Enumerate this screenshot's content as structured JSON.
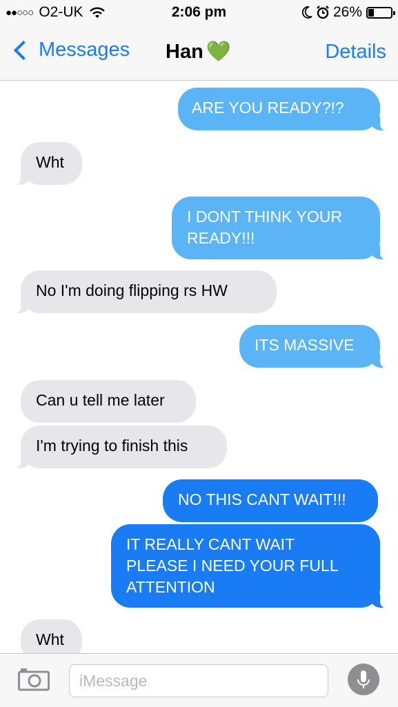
{
  "status_bar": {
    "signal": "●●○○○",
    "carrier": "O2-UK",
    "time": "2:06 pm",
    "battery_pct": "26%",
    "battery_level": 0.26
  },
  "nav": {
    "back_label": "Messages",
    "title": "Han",
    "title_emoji": "💚",
    "details_label": "Details"
  },
  "messages": [
    {
      "from": "me",
      "text": "ARE YOU READY?!?"
    },
    {
      "from": "them",
      "text": "Wht"
    },
    {
      "from": "me",
      "text": "I DONT THINK YOUR\nREADY!!!"
    },
    {
      "from": "them",
      "text": "No I'm doing flipping rs HW"
    },
    {
      "from": "me",
      "text": "ITS MASSIVE"
    },
    {
      "from": "them",
      "text": "Can u tell me later"
    },
    {
      "from": "them",
      "text": "I'm trying to finish this"
    },
    {
      "from": "me",
      "text": "NO THIS CANT WAIT!!!"
    },
    {
      "from": "me",
      "text": "IT REALLY CANT WAIT\nPLEASE I NEED YOUR FULL\nATTENTION"
    },
    {
      "from": "them",
      "text": "Wht"
    }
  ],
  "input": {
    "placeholder": "iMessage"
  },
  "colors": {
    "ios_blue": "#1a7cf4",
    "bubble_light_blue": "#5bb4f6",
    "bubble_gray": "#e6e6eb"
  },
  "icons": [
    "wifi-icon",
    "moon-icon",
    "alarm-icon",
    "battery-icon",
    "back-chevron-icon",
    "camera-icon",
    "microphone-icon"
  ]
}
